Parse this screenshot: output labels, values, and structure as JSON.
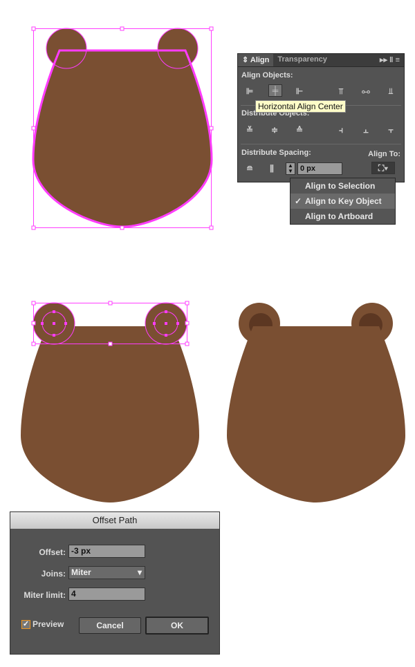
{
  "align_panel": {
    "tabs": [
      "Align",
      "Transparency"
    ],
    "align_objects": "Align Objects:",
    "distribute_objects": "Distribute Objects:",
    "distribute_spacing": "Distribute Spacing:",
    "align_to": "Align To:",
    "spacing_value": "0 px",
    "tooltip": "Horizontal Align Center"
  },
  "align_to_menu": {
    "items": [
      {
        "label": "Align to Selection",
        "checked": false
      },
      {
        "label": "Align to Key Object",
        "checked": true
      },
      {
        "label": "Align to Artboard",
        "checked": false
      }
    ]
  },
  "offset_dialog": {
    "title": "Offset Path",
    "offset_label": "Offset:",
    "offset_value": "-3 px",
    "joins_label": "Joins:",
    "joins_value": "Miter",
    "miter_label": "Miter limit:",
    "miter_value": "4",
    "preview_label": "Preview",
    "preview_checked": true,
    "cancel": "Cancel",
    "ok": "OK"
  },
  "colors": {
    "bear": "#7a4f32",
    "ear_inner": "#5c3722",
    "selection": "#ff3cff"
  }
}
